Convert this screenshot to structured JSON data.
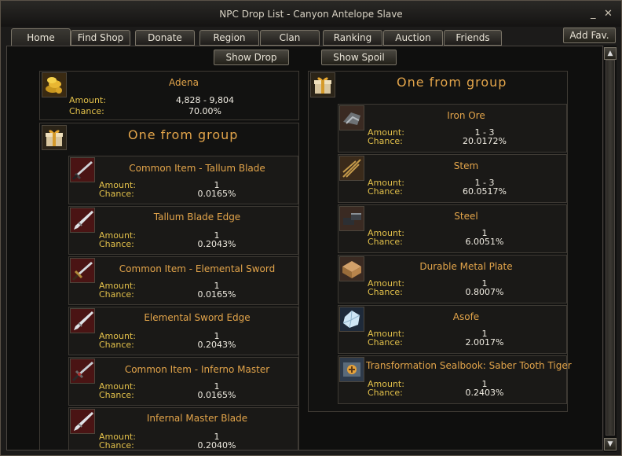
{
  "window": {
    "title": "NPC Drop List - Canyon Antelope Slave",
    "minimize_glyph": "_",
    "close_glyph": "✕"
  },
  "tabs": [
    "Home",
    "Find Shop",
    "Donate",
    "Region",
    "Clan",
    "Ranking",
    "Auction",
    "Friends"
  ],
  "add_fav_label": "Add Fav.",
  "buttons": {
    "show_drop": "Show Drop",
    "show_spoil": "Show Spoil"
  },
  "labels": {
    "amount": "Amount:",
    "chance": "Chance:"
  },
  "adena": {
    "name": "Adena",
    "amount": "4,828 - 9,804",
    "chance": "70.00%",
    "icon": "adena-icon"
  },
  "drop_group": {
    "title": "One from group",
    "items": [
      {
        "name": "Common Item - Tallum Blade",
        "amount": "1",
        "chance": "0.0165%",
        "icon": "tallum-blade-icon"
      },
      {
        "name": "Tallum Blade Edge",
        "amount": "1",
        "chance": "0.2043%",
        "icon": "blade-edge-icon"
      },
      {
        "name": "Common Item - Elemental Sword",
        "amount": "1",
        "chance": "0.0165%",
        "icon": "elemental-sword-icon"
      },
      {
        "name": "Elemental Sword Edge",
        "amount": "1",
        "chance": "0.2043%",
        "icon": "blade-edge-icon"
      },
      {
        "name": "Common Item - Inferno Master",
        "amount": "1",
        "chance": "0.0165%",
        "icon": "inferno-master-icon"
      },
      {
        "name": "Infernal Master Blade",
        "amount": "1",
        "chance": "0.2040%",
        "icon": "blade-edge-icon"
      }
    ]
  },
  "spoil_group": {
    "title": "One from group",
    "items": [
      {
        "name": "Iron Ore",
        "amount": "1 - 3",
        "chance": "20.0172%",
        "icon": "iron-ore-icon"
      },
      {
        "name": "Stem",
        "amount": "1 - 3",
        "chance": "60.0517%",
        "icon": "stem-icon"
      },
      {
        "name": "Steel",
        "amount": "1",
        "chance": "6.0051%",
        "icon": "steel-icon"
      },
      {
        "name": "Durable Metal Plate",
        "amount": "1",
        "chance": "0.8007%",
        "icon": "metal-plate-icon"
      },
      {
        "name": "Asofe",
        "amount": "1",
        "chance": "2.0017%",
        "icon": "asofe-icon"
      },
      {
        "name": "Transformation Sealbook: Saber Tooth Tiger",
        "amount": "1",
        "chance": "0.2403%",
        "icon": "sealbook-icon"
      }
    ]
  },
  "scrollbar": {
    "up_glyph": "▲",
    "down_glyph": "▼"
  }
}
